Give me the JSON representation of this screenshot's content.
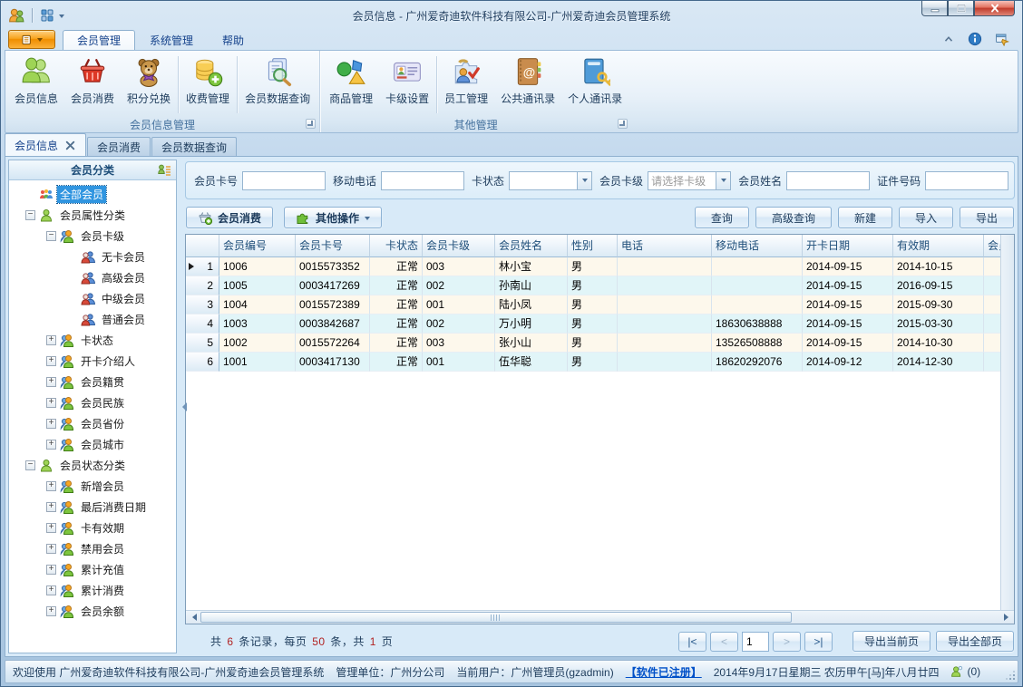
{
  "window": {
    "title": "会员信息 - 广州爱奇迪软件科技有限公司-广州爱奇迪会员管理系统"
  },
  "ribbon": {
    "tabs": [
      {
        "label": "会员管理",
        "active": true
      },
      {
        "label": "系统管理",
        "active": false
      },
      {
        "label": "帮助",
        "active": false
      }
    ],
    "groups": [
      {
        "label": "会员信息管理",
        "buttons": [
          {
            "label": "会员信息",
            "icon": "member-info-icon"
          },
          {
            "label": "会员消费",
            "icon": "basket-icon"
          },
          {
            "label": "积分兑换",
            "icon": "teddy-icon",
            "sep_after": true
          },
          {
            "label": "收费管理",
            "icon": "coins-icon",
            "sep_after": true
          },
          {
            "label": "会员数据查询",
            "icon": "doc-search-icon"
          }
        ]
      },
      {
        "label": "其他管理",
        "buttons": [
          {
            "label": "商品管理",
            "icon": "goods-icon"
          },
          {
            "label": "卡级设置",
            "icon": "card-icon",
            "sep_after": true
          },
          {
            "label": "员工管理",
            "icon": "staff-icon"
          },
          {
            "label": "公共通讯录",
            "icon": "public-contacts-icon"
          },
          {
            "label": "个人通讯录",
            "icon": "personal-contacts-icon"
          }
        ]
      }
    ]
  },
  "doc_tabs": [
    {
      "label": "会员信息",
      "active": true,
      "closable": true
    },
    {
      "label": "会员消费",
      "active": false
    },
    {
      "label": "会员数据查询",
      "active": false
    }
  ],
  "sidebar": {
    "header": "会员分类",
    "tree": [
      {
        "label": "全部会员",
        "level": 0,
        "icon": "group-color-icon",
        "selected": true
      },
      {
        "label": "会员属性分类",
        "level": 0,
        "icon": "person-green-icon",
        "expander": "minus"
      },
      {
        "label": "会员卡级",
        "level": 1,
        "icon": "people-orange-icon",
        "expander": "minus"
      },
      {
        "label": "无卡会员",
        "level": 2,
        "icon": "people-pair-icon"
      },
      {
        "label": "高级会员",
        "level": 2,
        "icon": "people-pair-icon"
      },
      {
        "label": "中级会员",
        "level": 2,
        "icon": "people-pair-icon"
      },
      {
        "label": "普通会员",
        "level": 2,
        "icon": "people-pair-icon"
      },
      {
        "label": "卡状态",
        "level": 1,
        "icon": "people-orange-icon",
        "expander": "plus"
      },
      {
        "label": "开卡介绍人",
        "level": 1,
        "icon": "people-orange-icon",
        "expander": "plus"
      },
      {
        "label": "会员籍贯",
        "level": 1,
        "icon": "people-orange-icon",
        "expander": "plus"
      },
      {
        "label": "会员民族",
        "level": 1,
        "icon": "people-orange-icon",
        "expander": "plus"
      },
      {
        "label": "会员省份",
        "level": 1,
        "icon": "people-orange-icon",
        "expander": "plus"
      },
      {
        "label": "会员城市",
        "level": 1,
        "icon": "people-orange-icon",
        "expander": "plus"
      },
      {
        "label": "会员状态分类",
        "level": 0,
        "icon": "person-green-icon",
        "expander": "minus"
      },
      {
        "label": "新增会员",
        "level": 1,
        "icon": "people-orange-icon",
        "expander": "plus"
      },
      {
        "label": "最后消费日期",
        "level": 1,
        "icon": "people-orange-icon",
        "expander": "plus"
      },
      {
        "label": "卡有效期",
        "level": 1,
        "icon": "people-orange-icon",
        "expander": "plus"
      },
      {
        "label": "禁用会员",
        "level": 1,
        "icon": "people-orange-icon",
        "expander": "plus"
      },
      {
        "label": "累计充值",
        "level": 1,
        "icon": "people-orange-icon",
        "expander": "plus"
      },
      {
        "label": "累计消费",
        "level": 1,
        "icon": "people-orange-icon",
        "expander": "plus"
      },
      {
        "label": "会员余额",
        "level": 1,
        "icon": "people-orange-icon",
        "expander": "plus"
      }
    ]
  },
  "search": {
    "fields": [
      {
        "label": "会员卡号",
        "type": "text",
        "value": ""
      },
      {
        "label": "移动电话",
        "type": "text",
        "value": ""
      },
      {
        "label": "卡状态",
        "type": "select",
        "value": ""
      },
      {
        "label": "会员卡级",
        "type": "select",
        "value": "请选择卡级",
        "placeholder": true
      },
      {
        "label": "会员姓名",
        "type": "text",
        "value": ""
      },
      {
        "label": "证件号码",
        "type": "text",
        "value": ""
      }
    ]
  },
  "toolbar": {
    "left": [
      {
        "label": "会员消费",
        "icon": "basket-add-icon"
      },
      {
        "label": "其他操作",
        "icon": "puzzle-icon",
        "dropdown": true
      }
    ],
    "right": [
      "查询",
      "高级查询",
      "新建",
      "导入",
      "导出"
    ]
  },
  "table": {
    "columns": [
      {
        "label": "",
        "width": 37
      },
      {
        "label": "会员编号",
        "width": 84
      },
      {
        "label": "会员卡号",
        "width": 82
      },
      {
        "label": "卡状态",
        "width": 58,
        "align": "right"
      },
      {
        "label": "会员卡级",
        "width": 80
      },
      {
        "label": "会员姓名",
        "width": 80
      },
      {
        "label": "性别",
        "width": 55
      },
      {
        "label": "电话",
        "width": 104
      },
      {
        "label": "移动电话",
        "width": 100
      },
      {
        "label": "开卡日期",
        "width": 100
      },
      {
        "label": "有效期",
        "width": 100
      },
      {
        "label": "会员",
        "width": 46
      }
    ],
    "rows": [
      {
        "num": "1",
        "current": true,
        "cells": [
          "1006",
          "0015573352",
          "正常",
          "003",
          "林小宝",
          "男",
          "",
          "",
          "2014-09-15",
          "2014-10-15",
          ""
        ]
      },
      {
        "num": "2",
        "current": false,
        "cells": [
          "1005",
          "0003417269",
          "正常",
          "002",
          "孙南山",
          "男",
          "",
          "",
          "2014-09-15",
          "2016-09-15",
          ""
        ]
      },
      {
        "num": "3",
        "current": false,
        "cells": [
          "1004",
          "0015572389",
          "正常",
          "001",
          "陆小凤",
          "男",
          "",
          "",
          "2014-09-15",
          "2015-09-30",
          ""
        ]
      },
      {
        "num": "4",
        "current": false,
        "cells": [
          "1003",
          "0003842687",
          "正常",
          "002",
          "万小明",
          "男",
          "",
          "18630638888",
          "2014-09-15",
          "2015-03-30",
          ""
        ]
      },
      {
        "num": "5",
        "current": false,
        "cells": [
          "1002",
          "0015572264",
          "正常",
          "003",
          "张小山",
          "男",
          "",
          "13526508888",
          "2014-09-15",
          "2014-10-30",
          ""
        ]
      },
      {
        "num": "6",
        "current": false,
        "cells": [
          "1001",
          "0003417130",
          "正常",
          "001",
          "伍华聪",
          "男",
          "",
          "18620292076",
          "2014-09-12",
          "2014-12-30",
          ""
        ]
      }
    ]
  },
  "pager": {
    "summary": [
      {
        "t": "共 "
      },
      {
        "t": "6",
        "hl": true
      },
      {
        "t": " 条记录，每页 "
      },
      {
        "t": "50",
        "hl": true
      },
      {
        "t": " 条，共 "
      },
      {
        "t": "1",
        "hl": true
      },
      {
        "t": " 页"
      }
    ],
    "nav": {
      "first": "|<",
      "prev": "<",
      "next": ">",
      "last": ">|"
    },
    "page": "1",
    "export_current": "导出当前页",
    "export_all": "导出全部页"
  },
  "statusbar": {
    "welcome": "欢迎使用 广州爱奇迪软件科技有限公司-广州爱奇迪会员管理系统",
    "unit": "管理单位：广州分公司",
    "user": "当前用户：广州管理员(gzadmin)",
    "registered": "【软件已注册】",
    "date": "2014年9月17日星期三 农历甲午[马]年八月廿四",
    "count": "(0)"
  }
}
